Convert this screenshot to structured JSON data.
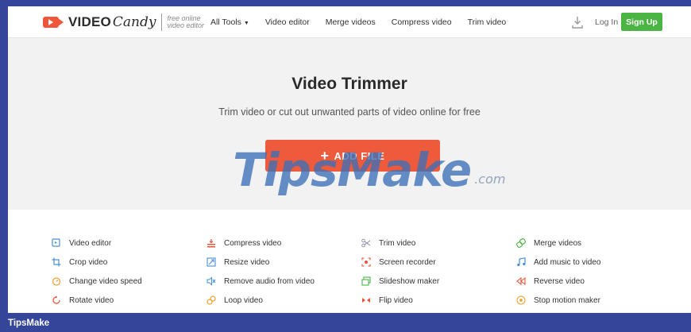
{
  "header": {
    "logo_video": "VIDEO",
    "logo_candy": "Candy",
    "logo_tag_line1": "free online",
    "logo_tag_line2": "video editor",
    "nav": [
      {
        "label": "All Tools",
        "caret": "▼"
      },
      {
        "label": "Video editor"
      },
      {
        "label": "Merge videos"
      },
      {
        "label": "Compress video"
      },
      {
        "label": "Trim video"
      }
    ],
    "login": "Log In",
    "signup": "Sign Up"
  },
  "hero": {
    "title": "Video Trimmer",
    "subtitle": "Trim video or cut out unwanted parts of video online for free",
    "add_file_plus": "+",
    "add_file": "ADD FILE"
  },
  "watermark": {
    "main": "TipsMake",
    "suffix": ".com"
  },
  "tools": [
    [
      {
        "label": "Video editor",
        "icon": "video-editor-icon",
        "color": "#4a90d9"
      },
      {
        "label": "Crop video",
        "icon": "crop-icon",
        "color": "#4a90d9"
      },
      {
        "label": "Change video speed",
        "icon": "speed-icon",
        "color": "#f0a030"
      },
      {
        "label": "Rotate video",
        "icon": "rotate-icon",
        "color": "#e8553a"
      }
    ],
    [
      {
        "label": "Compress video",
        "icon": "compress-icon",
        "color": "#e8553a"
      },
      {
        "label": "Resize video",
        "icon": "resize-icon",
        "color": "#4a90d9"
      },
      {
        "label": "Remove audio from video",
        "icon": "mute-icon",
        "color": "#4a90d9"
      },
      {
        "label": "Loop video",
        "icon": "loop-icon",
        "color": "#f0a030"
      }
    ],
    [
      {
        "label": "Trim video",
        "icon": "scissors-icon",
        "color": "#9a9ab0"
      },
      {
        "label": "Screen recorder",
        "icon": "record-icon",
        "color": "#e8553a"
      },
      {
        "label": "Slideshow maker",
        "icon": "slideshow-icon",
        "color": "#4bb543"
      },
      {
        "label": "Flip video",
        "icon": "flip-icon",
        "color": "#e8553a"
      }
    ],
    [
      {
        "label": "Merge videos",
        "icon": "merge-icon",
        "color": "#4bb543"
      },
      {
        "label": "Add music to video",
        "icon": "music-icon",
        "color": "#4a90d9"
      },
      {
        "label": "Reverse video",
        "icon": "reverse-icon",
        "color": "#e8553a"
      },
      {
        "label": "Stop motion maker",
        "icon": "stop-motion-icon",
        "color": "#f0a030"
      }
    ]
  ],
  "footer": {
    "brand": "TipsMake"
  },
  "colors": {
    "accent_orange": "#ee5a3c",
    "signup_green": "#4bb543",
    "frame_blue": "#34459a"
  }
}
